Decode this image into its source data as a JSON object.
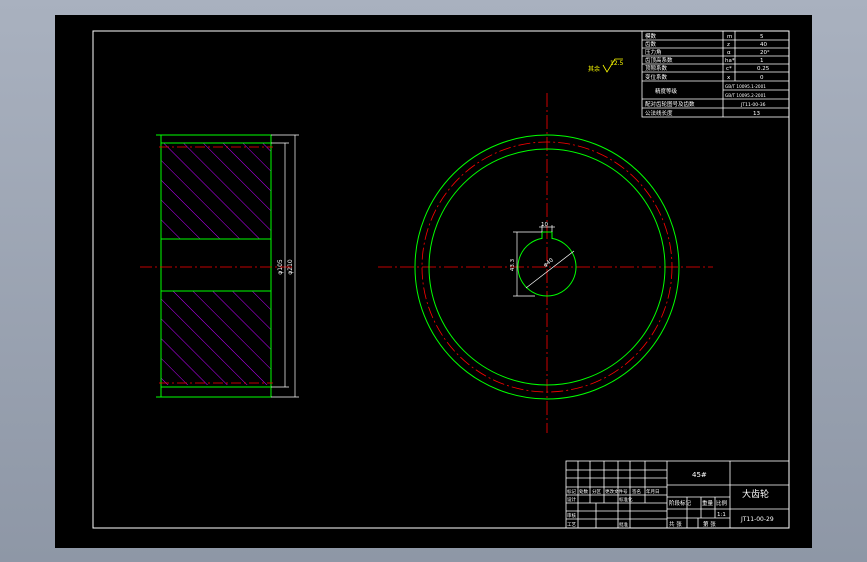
{
  "gear_params": {
    "rows": [
      {
        "label": "模数",
        "symbol": "m",
        "value": "5"
      },
      {
        "label": "齿数",
        "symbol": "z",
        "value": "40"
      },
      {
        "label": "压力角",
        "symbol": "α",
        "value": "20°"
      },
      {
        "label": "齿顶高系数",
        "symbol": "ha*",
        "value": "1"
      },
      {
        "label": "顶隙系数",
        "symbol": "c*",
        "value": "0.25"
      },
      {
        "label": "变位系数",
        "symbol": "x",
        "value": "0"
      }
    ],
    "accuracy_label": "精度等级",
    "accuracy_values": [
      "GB/T 10095.1-2001",
      "GB/T 10095.2-2001"
    ],
    "mating_label": "配对齿轮图号及齿数",
    "mating_value": "JT11-00-36",
    "common_normal_label": "公法线长度",
    "common_normal_value": "13"
  },
  "roughness": {
    "label": "其余",
    "value": "12.5"
  },
  "section_dims": {
    "outer_dia": "φ210",
    "bore_dia": "φ105"
  },
  "keyway_dims": {
    "width": "10",
    "depth": "43.3",
    "bore": "φ40"
  },
  "title_block": {
    "material": "45#",
    "part_name": "大齿轮",
    "drawing_no": "JT11-00-29",
    "scale": "1:1",
    "stage_label": "阶段标记",
    "weight_label": "重量",
    "scale_label": "比例",
    "sheet_total": "共 张",
    "sheet_no": "第 张",
    "designer_label": "设计",
    "standardize_label": "标准化",
    "checker_label": "审核",
    "process_label": "工艺",
    "approve_label": "批准",
    "revision_headers": [
      "标记",
      "处数",
      "分区",
      "更改文件号",
      "签名",
      "年月日"
    ]
  }
}
